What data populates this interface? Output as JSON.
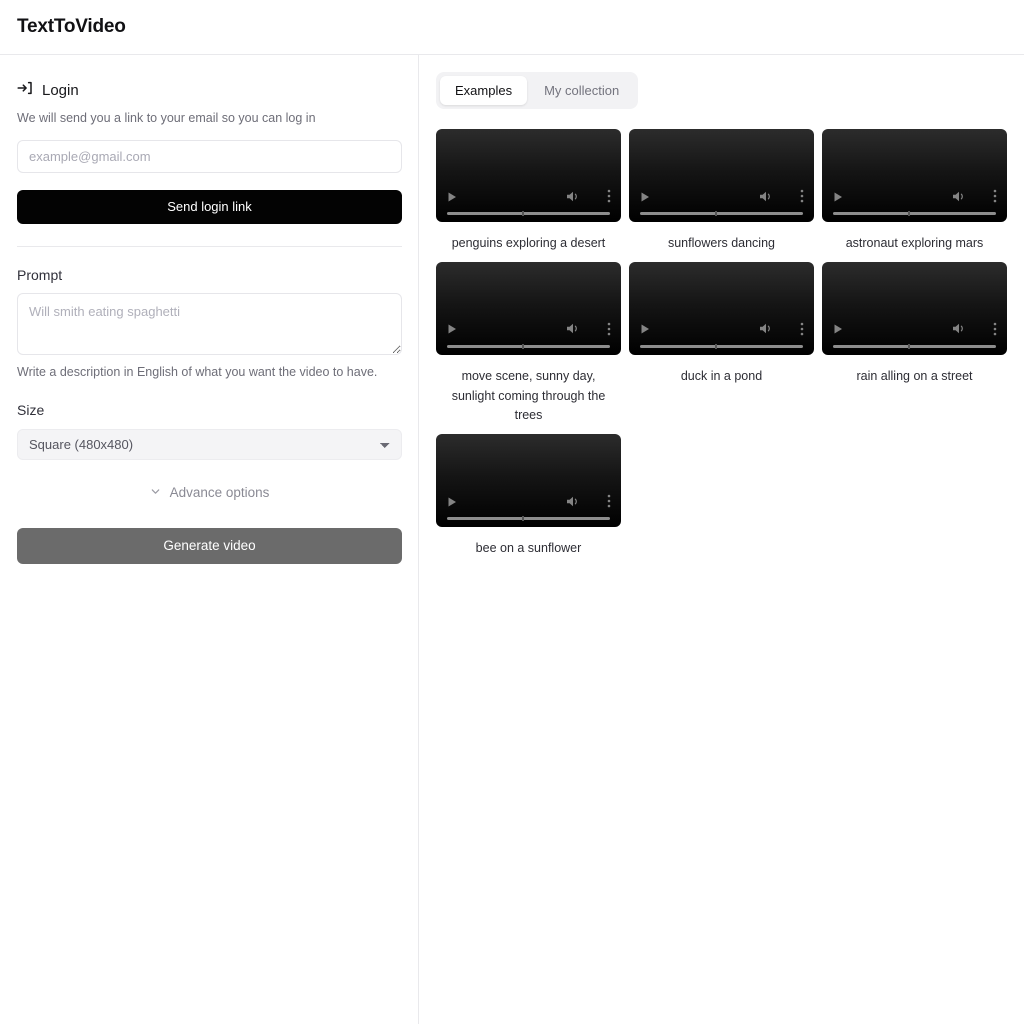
{
  "header": {
    "title": "TextToVideo"
  },
  "sidebar": {
    "login": {
      "icon": "login-icon",
      "heading": "Login",
      "description": "We will send you a link to your email so you can log in",
      "email_placeholder": "example@gmail.com",
      "email_value": "",
      "submit_label": "Send login link"
    },
    "prompt": {
      "label": "Prompt",
      "placeholder": "Will smith eating spaghetti",
      "value": "",
      "helper": "Write a description in English of what you want the video to have."
    },
    "size": {
      "label": "Size",
      "selected": "Square (480x480)",
      "options": [
        "Square (480x480)"
      ]
    },
    "advance_options": {
      "label": "Advance options",
      "icon": "chevron-down-icon",
      "expanded": false
    },
    "generate": {
      "label": "Generate video",
      "disabled": true,
      "color": "#6b6b6b"
    }
  },
  "main": {
    "tabs": [
      {
        "label": "Examples",
        "active": true
      },
      {
        "label": "My collection",
        "active": false
      }
    ],
    "videos": [
      {
        "caption": "penguins exploring a desert"
      },
      {
        "caption": "sunflowers dancing"
      },
      {
        "caption": "astronaut exploring mars"
      },
      {
        "caption": "move scene, sunny day, sunlight coming through the trees"
      },
      {
        "caption": "duck in a pond"
      },
      {
        "caption": "rain alling on a street"
      },
      {
        "caption": "bee on a sunflower"
      }
    ],
    "player_controls": {
      "play": "play-icon",
      "volume": "volume-icon",
      "menu": "kebab-menu-icon"
    }
  }
}
